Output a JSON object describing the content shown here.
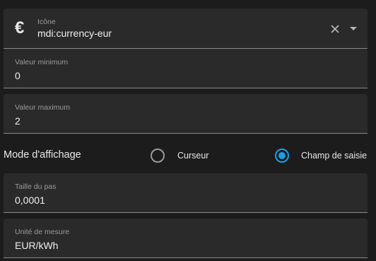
{
  "icon_field": {
    "glyph": "€",
    "label": "Icône",
    "value": "mdi:currency-eur"
  },
  "min_field": {
    "label": "Valeur minimum",
    "value": "0"
  },
  "max_field": {
    "label": "Valeur maximum",
    "value": "2"
  },
  "display_mode": {
    "title": "Mode d'affichage",
    "options": [
      {
        "label": "Curseur",
        "selected": false
      },
      {
        "label": "Champ de saisie",
        "selected": true
      }
    ]
  },
  "step_field": {
    "label": "Taille du pas",
    "value": "0,0001"
  },
  "unit_field": {
    "label": "Unité de mesure",
    "value": "EUR/kWh"
  },
  "colors": {
    "accent": "#1a9ee6",
    "background": "#1c1c1c",
    "field_background": "#2a2a2a"
  }
}
